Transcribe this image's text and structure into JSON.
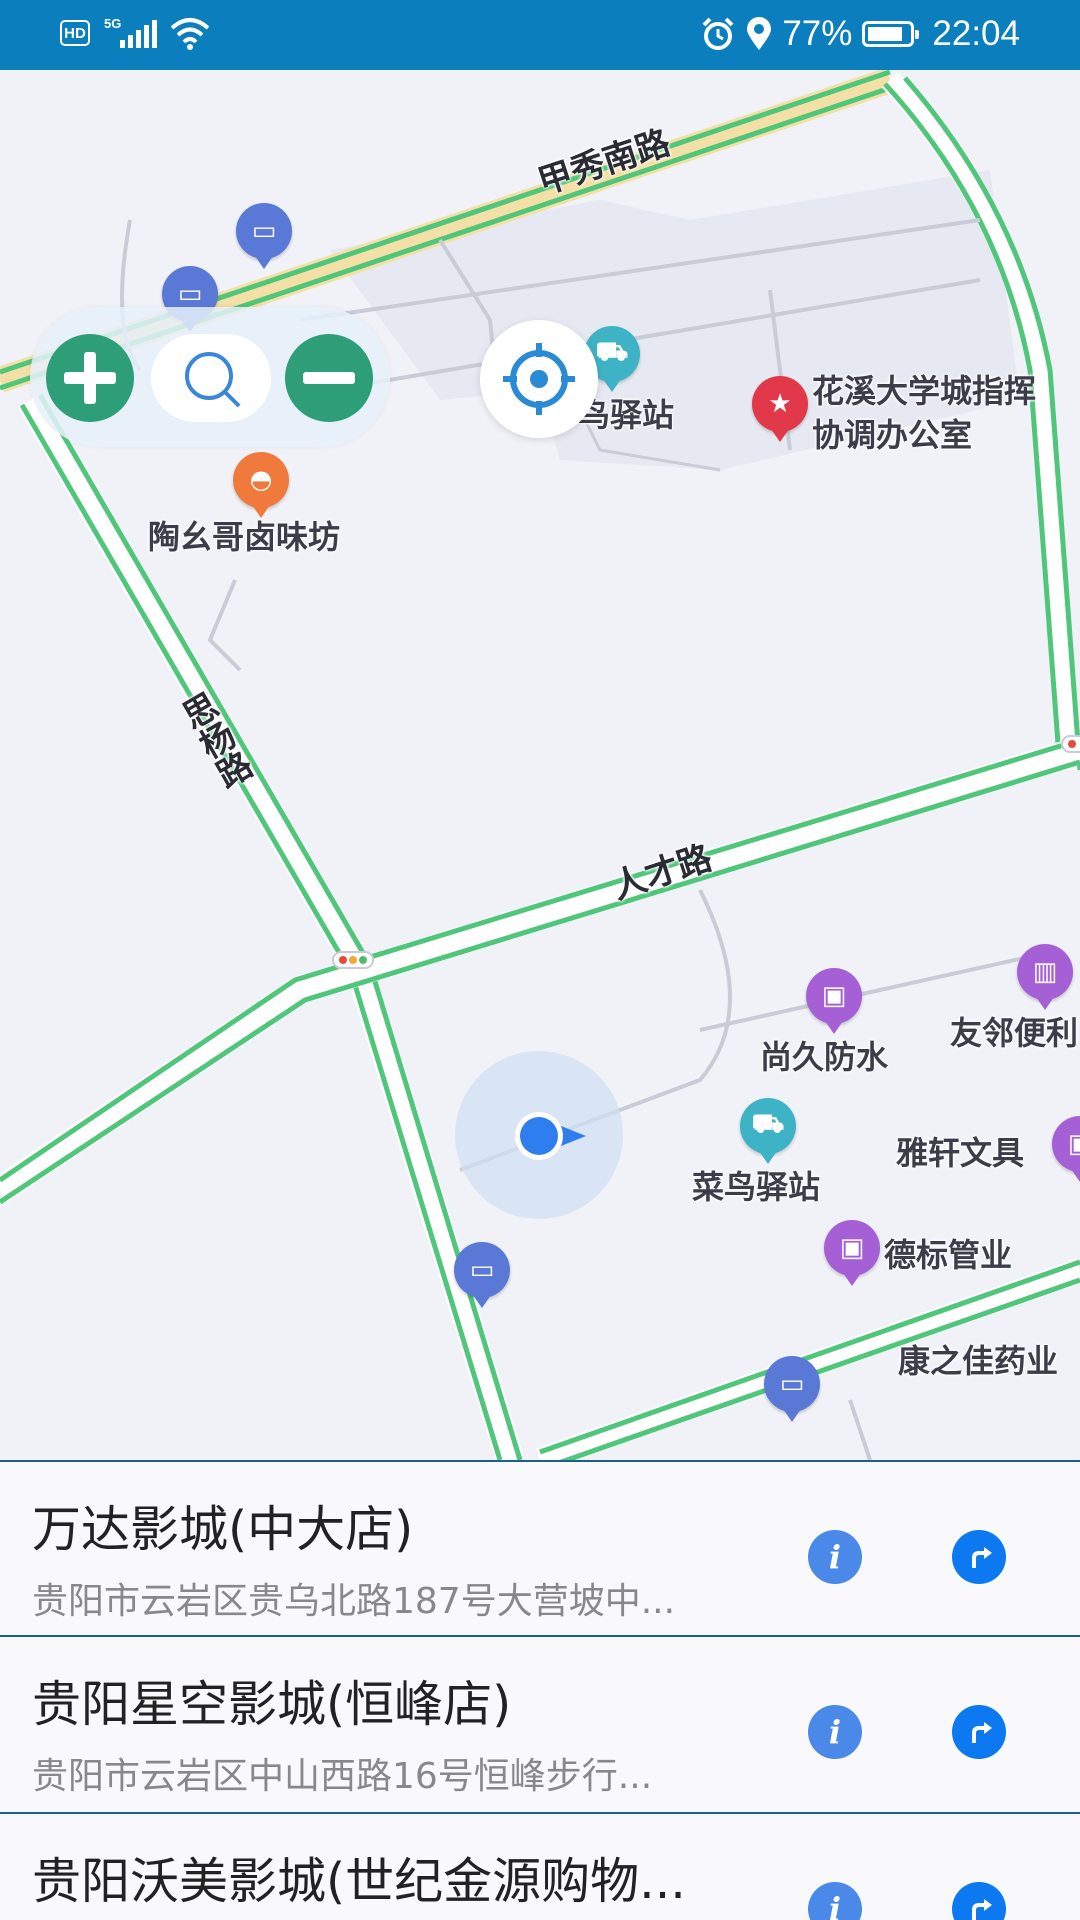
{
  "status_bar": {
    "hd_label": "HD",
    "network_label": "5G",
    "battery_percent": "77%",
    "battery_level": 0.77,
    "time": "22:04"
  },
  "map": {
    "road_labels": {
      "jiaxiu_south_road": "甲秀南路",
      "siyang_road": "思杨路",
      "rencai_road": "人才路"
    },
    "poi_labels": {
      "huaxi_office_line1": "花溪大学城指挥",
      "huaxi_office_line2": "协调办公室",
      "cainiao_top": "鸟驿站",
      "taoyaoge": "陶幺哥卤味坊",
      "shangjiu": "尚久防水",
      "youlin": "友邻便利",
      "cainiao": "菜鸟驿站",
      "yaxuan": "雅轩文具",
      "debiao": "德标管业",
      "kangzhijia": "康之佳药业"
    },
    "icons": {
      "zoom_in": "plus-icon",
      "search": "search-icon",
      "zoom_out": "minus-icon",
      "locate": "crosshair-icon",
      "my_location": "location-arrow-icon"
    },
    "colors": {
      "zoom_buttons": "#2e9e78",
      "road_green": "#4fc67a",
      "location_dot": "#2f7ef0"
    }
  },
  "results": [
    {
      "title": "万达影城(中大店)",
      "address": "贵阳市云岩区贵乌北路187号大营坡中...",
      "info_label": "i"
    },
    {
      "title": "贵阳星空影城(恒峰店)",
      "address": "贵阳市云岩区中山西路16号恒峰步行...",
      "info_label": "i"
    },
    {
      "title": "贵阳沃美影城(世纪金源购物...",
      "address": "",
      "info_label": "i"
    }
  ]
}
